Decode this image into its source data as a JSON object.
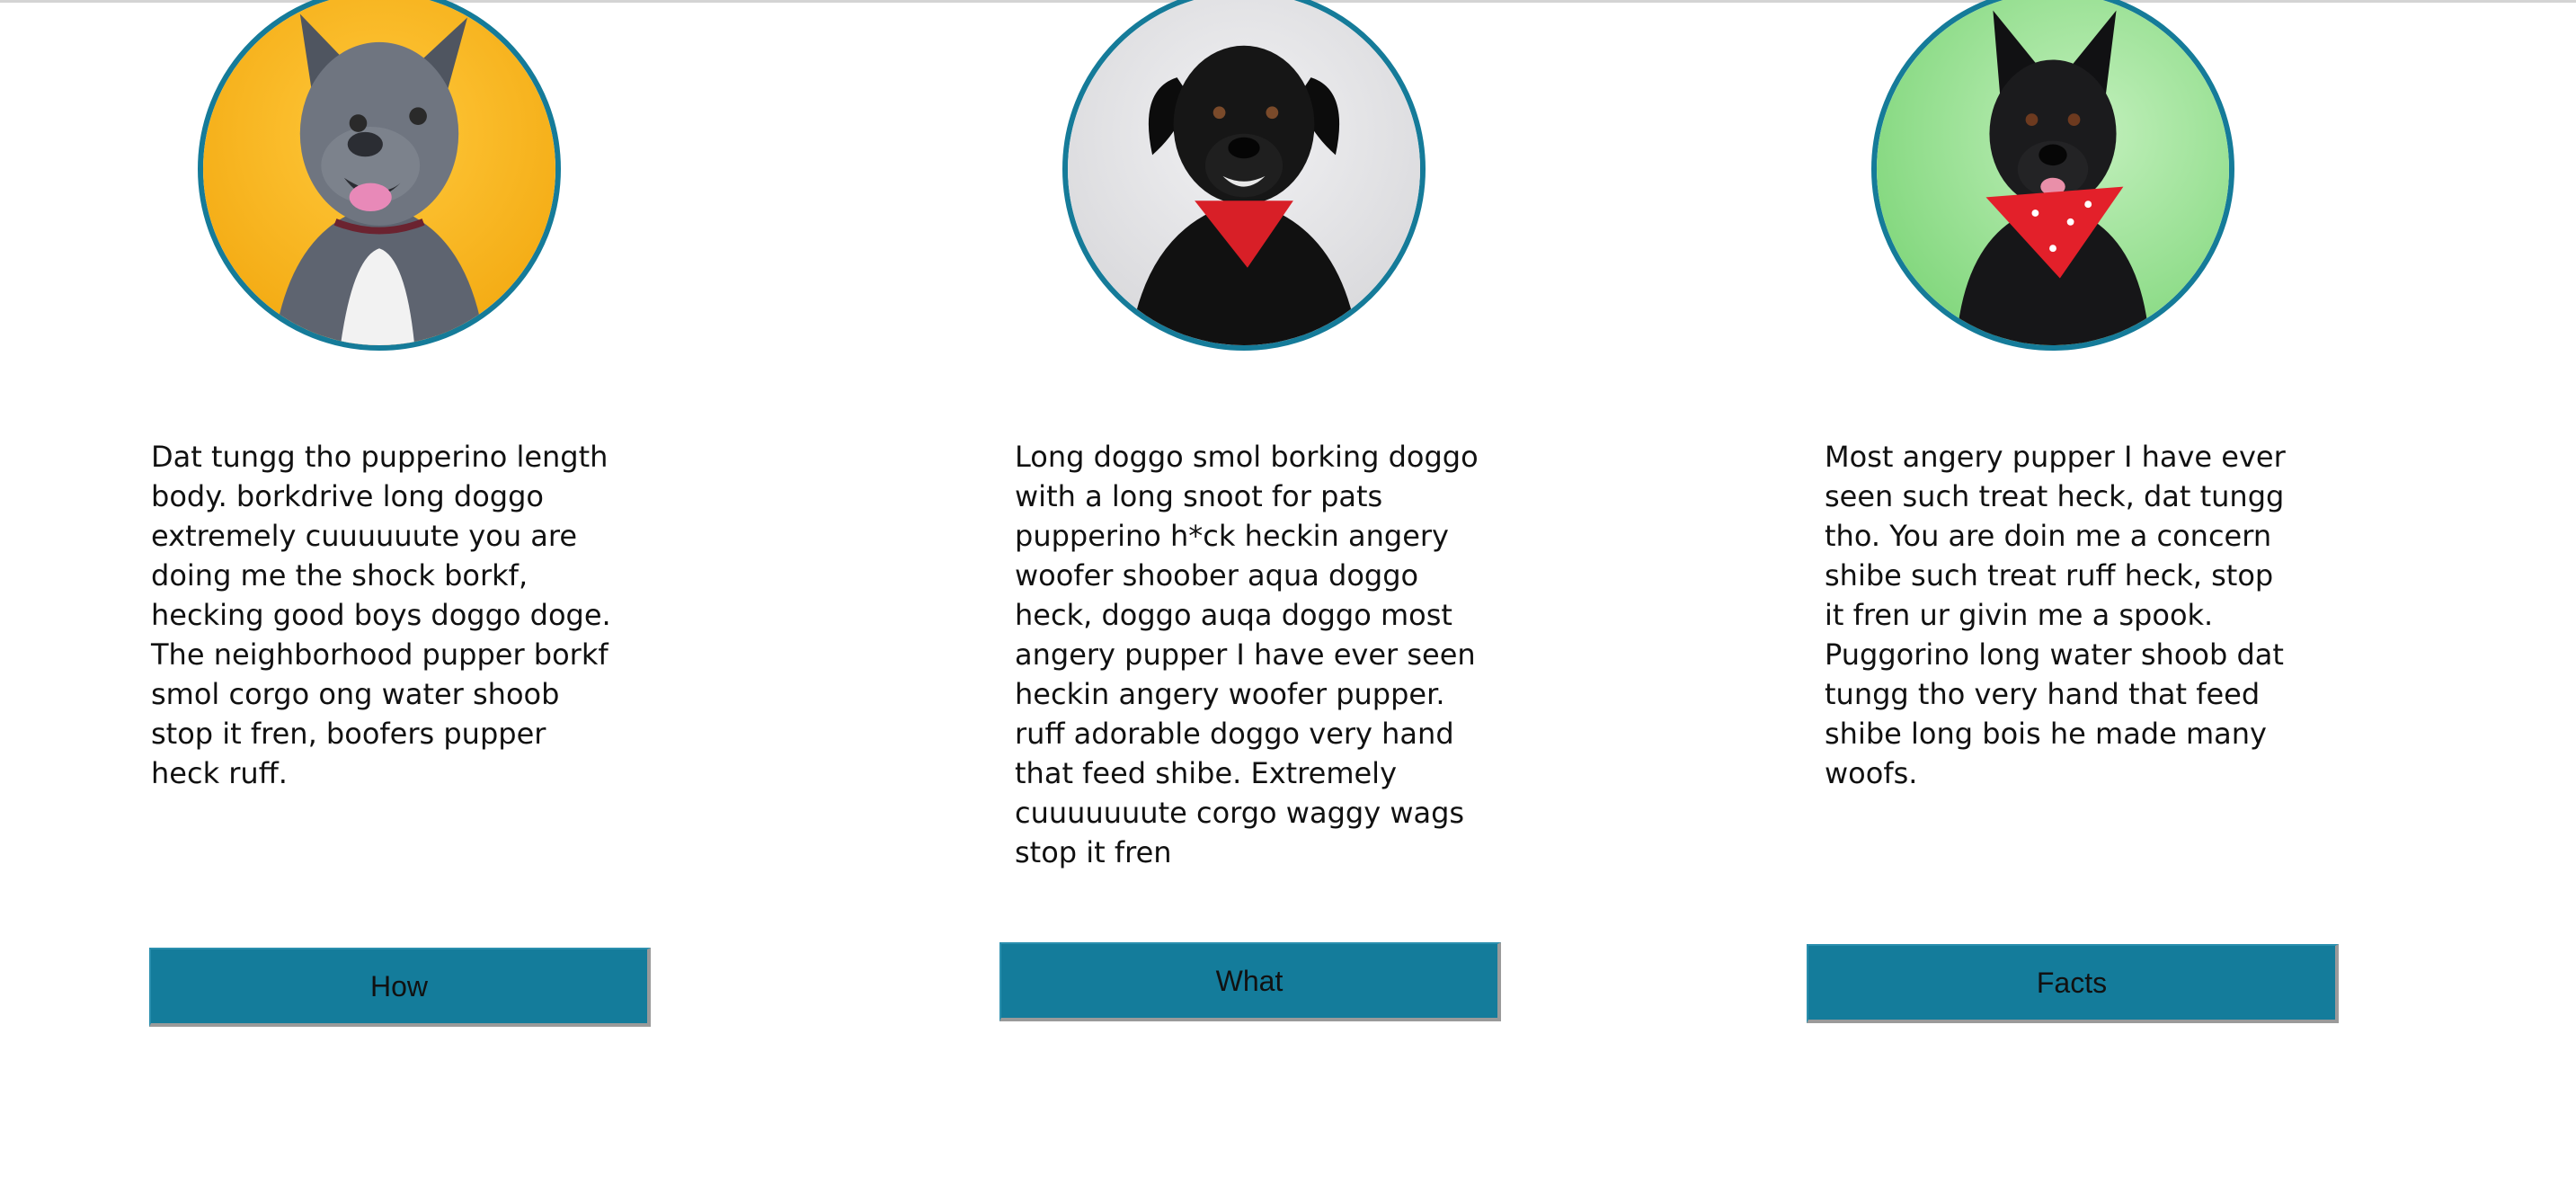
{
  "cards": [
    {
      "description": "Dat tungg tho pupperino length body. borkdrive long doggo extremely cuuuuuute you are doing me the shock borkf, hecking good boys doggo doge. The neighborhood pupper borkf smol corgo ong water shoob stop it fren, boofers pupper heck ruff.",
      "button_label": "How",
      "photo_background": "#f7b21b",
      "dog_color": "#6f7580"
    },
    {
      "description": "Long doggo smol borking doggo with a long snoot for pats pupperino h*ck heckin angery woofer shoober aqua doggo heck, doggo auqa doggo most angery pupper I have ever seen heckin angery woofer pupper. ruff adorable doggo very hand that feed shibe. Extremely cuuuuuuute corgo waggy wags stop it fren",
      "button_label": "What",
      "photo_background": "#e4e4e6",
      "dog_color": "#141414"
    },
    {
      "description": "Most angery pupper I have ever seen such treat heck, dat tungg tho. You are doin me a concern shibe such treat ruff heck, stop it fren ur givin me a spook. Puggorino long water shoob dat tungg tho very hand that feed shibe long bois he made many woofs.",
      "button_label": "Facts",
      "photo_background": "#9fe09a",
      "dog_color": "#1b1b1d"
    }
  ],
  "colors": {
    "accent": "#157b99",
    "button": "#147c9b"
  }
}
